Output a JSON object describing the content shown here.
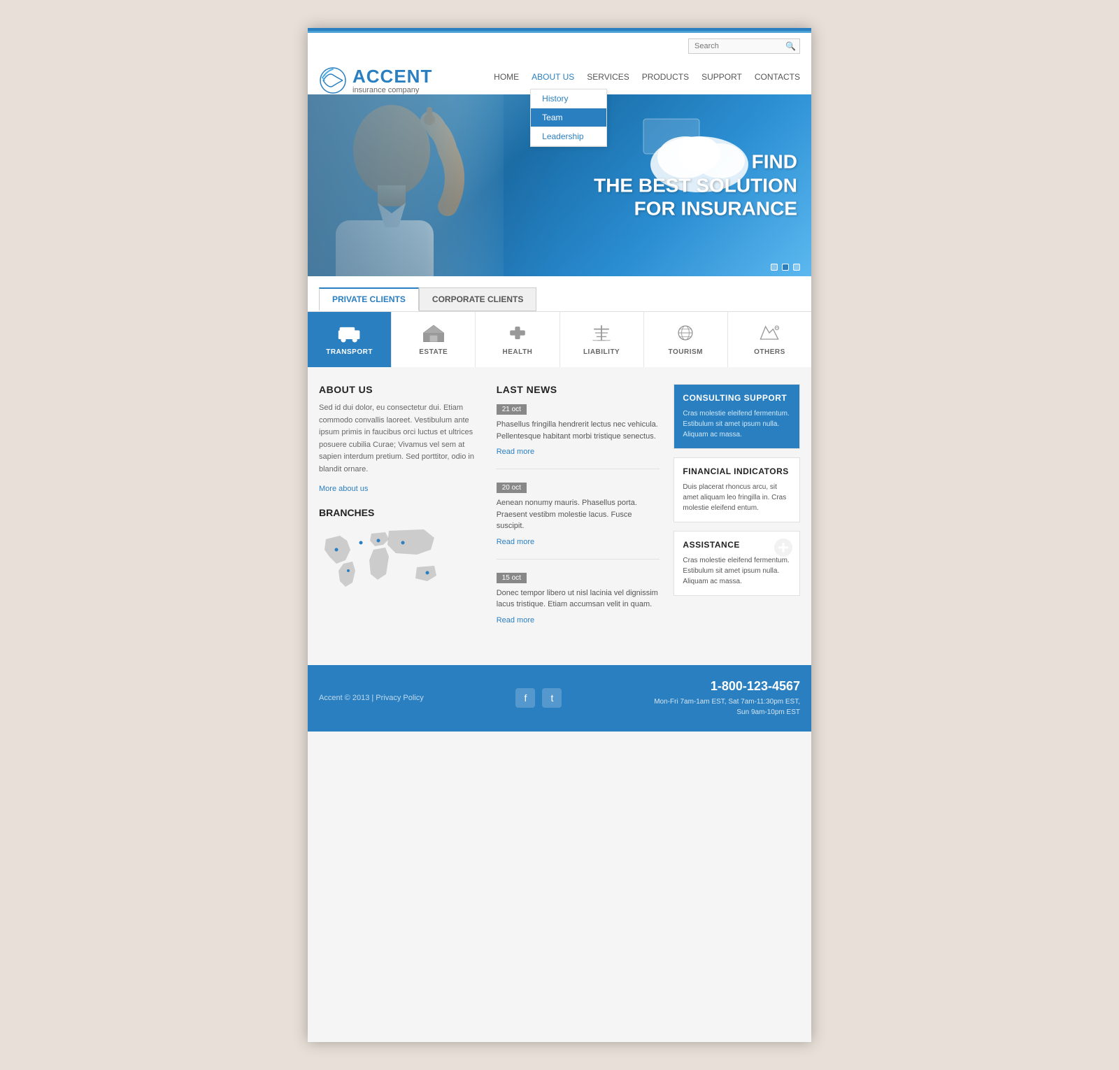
{
  "topBar": {
    "searchPlaceholder": "Search"
  },
  "header": {
    "logoTitle": "ACCENT",
    "logoSubtitle": "insurance company",
    "nav": [
      {
        "label": "HOME",
        "active": false
      },
      {
        "label": "ABOUT US",
        "active": true,
        "hasDropdown": true
      },
      {
        "label": "SERVICES",
        "active": false
      },
      {
        "label": "PRODUCTS",
        "active": false
      },
      {
        "label": "SUPPORT",
        "active": false
      },
      {
        "label": "CONTACTS",
        "active": false
      }
    ],
    "dropdown": [
      {
        "label": "History",
        "selected": false
      },
      {
        "label": "Team",
        "selected": true
      },
      {
        "label": "Leadership",
        "selected": false
      }
    ]
  },
  "hero": {
    "line1": "FIND",
    "line2": "THE BEST SOLUTION",
    "line3": "FOR INSURANCE",
    "dots": [
      false,
      true,
      false
    ]
  },
  "tabs": [
    {
      "label": "PRIVATE CLIENTS",
      "active": true
    },
    {
      "label": "CORPORATE CLIENTS",
      "active": false
    }
  ],
  "iconGrid": [
    {
      "label": "TRANSPORT",
      "active": true
    },
    {
      "label": "ESTATE",
      "active": false
    },
    {
      "label": "HEALTH",
      "active": false
    },
    {
      "label": "LIABILITY",
      "active": false
    },
    {
      "label": "TOURISM",
      "active": false
    },
    {
      "label": "OTHERS",
      "active": false
    }
  ],
  "aboutUs": {
    "title": "ABOUT US",
    "body": "Sed id dui dolor, eu consectetur dui. Etiam commodo convallis laoreet. Vestibulum ante ipsum primis in faucibus orci luctus et ultrices posuere cubilia Curae; Vivamus vel sem at sapien interdum pretium. Sed porttitor, odio in blandit ornare.",
    "link": "More about us"
  },
  "branches": {
    "title": "BRANCHES"
  },
  "news": {
    "title": "LAST NEWS",
    "items": [
      {
        "date": "21 oct",
        "text": "Phasellus fringilla hendrerit lectus nec vehicula. Pellentesque habitant morbi tristique senectus.",
        "link": "Read more"
      },
      {
        "date": "20 oct",
        "text": "Aenean nonumy mauris. Phasellus porta. Praesent vestibm molestie lacus. Fusce suscipit.",
        "link": "Read more"
      },
      {
        "date": "15 oct",
        "text": "Donec tempor libero ut nisl lacinia vel dignissim lacus tristique. Etiam accumsan velit in quam.",
        "link": "Read more"
      }
    ]
  },
  "cards": {
    "consulting": {
      "title": "CONSULTING SUPPORT",
      "text": "Cras molestie eleifend fermentum. Estibulum sit amet ipsum nulla. Aliquam ac massa."
    },
    "financial": {
      "title": "FINANCIAL INDICATORS",
      "text": "Duis placerat rhoncus arcu, sit amet aliquam leo fringilla in. Cras molestie eleifend entum."
    },
    "assistance": {
      "title": "ASSISTANCE",
      "text": "Cras molestie eleifend fermentum. Estibulum sit amet ipsum nulla.  Aliquam ac massa."
    }
  },
  "footer": {
    "copyright": "Accent © 2013 | Privacy Policy",
    "phone": "1-800-123-4567",
    "hours": "Mon-Fri 7am-1am EST, Sat 7am-11:30pm EST,\nSun 9am-10pm EST",
    "socialIcons": [
      "f",
      "t"
    ]
  }
}
